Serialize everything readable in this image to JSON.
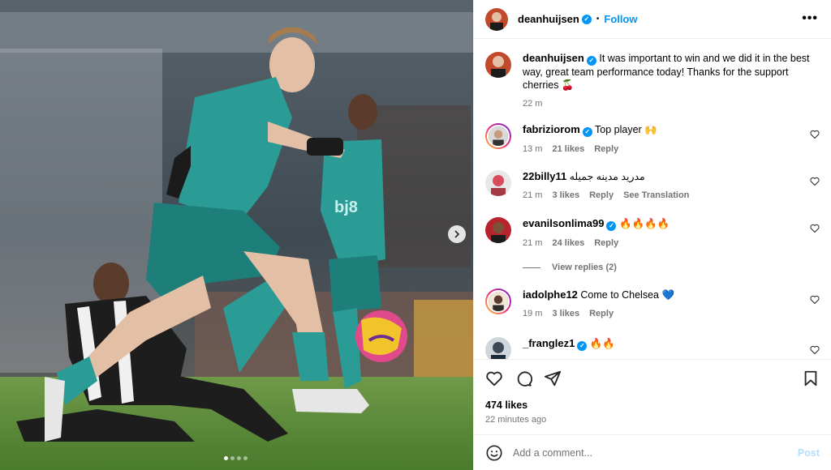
{
  "post": {
    "username": "deanhuijsen",
    "follow_label": "Follow",
    "separator": "•",
    "more_icon": "more-horizontal-icon",
    "caption": "It was important to win and we did it in the best way, great team performance today! Thanks for the support cherries 🍒",
    "caption_time": "22 m",
    "likes": "474 likes",
    "time_ago": "22 minutes ago",
    "photo_dots": 4,
    "active_dot": 0
  },
  "comments": [
    {
      "username": "fabriziorom",
      "verified": true,
      "text": "Top player 🙌",
      "time": "13 m",
      "likes": "21 likes",
      "reply": "Reply"
    },
    {
      "username": "22billy11",
      "verified": false,
      "text": "مدريد مدينه جميله",
      "time": "21 m",
      "likes": "3 likes",
      "reply": "Reply",
      "translate": "See Translation"
    },
    {
      "username": "evanilsonlima99",
      "verified": true,
      "text": "🔥🔥🔥🔥",
      "time": "21 m",
      "likes": "24 likes",
      "reply": "Reply"
    },
    {
      "username": "iadolphe12",
      "verified": false,
      "text": "Come to Chelsea 💙",
      "time": "19 m",
      "likes": "3 likes",
      "reply": "Reply"
    },
    {
      "username": "_franglez1",
      "verified": true,
      "text": "🔥🔥",
      "time": "",
      "likes": "",
      "reply": ""
    }
  ],
  "view_replies": "View replies (2)",
  "composer": {
    "placeholder": "Add a comment...",
    "post_label": "Post"
  },
  "colors": {
    "accent": "#0095f6",
    "kit_teal": "#1f8f8a",
    "pitch": "#4f7d33"
  }
}
